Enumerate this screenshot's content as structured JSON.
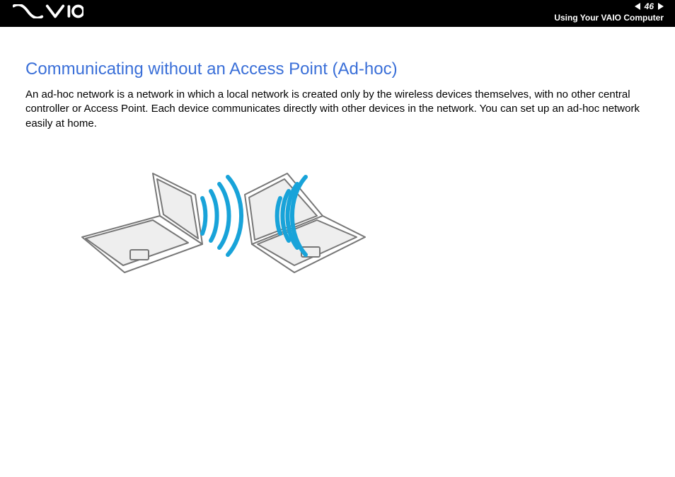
{
  "header": {
    "logo_alt": "VAIO",
    "page_number": "46",
    "section": "Using Your VAIO Computer"
  },
  "content": {
    "title": "Communicating without an Access Point (Ad-hoc)",
    "paragraph": "An ad-hoc network is a network in which a local network is created only by the wireless devices themselves, with no other central controller or Access Point. Each device communicates directly with other devices in the network. You can set up an ad-hoc network easily at home."
  }
}
